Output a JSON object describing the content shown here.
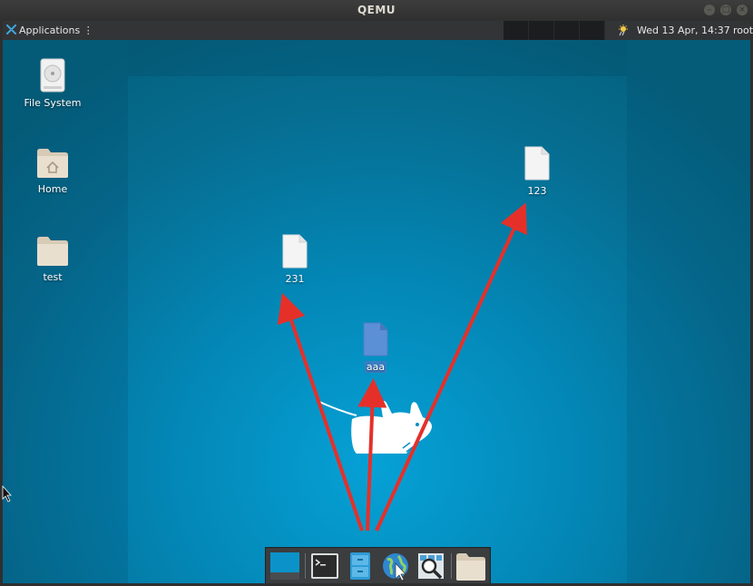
{
  "window": {
    "title": "QEMU"
  },
  "panel": {
    "applications_label": "Applications",
    "applications_suffix": "⋮",
    "clock": "Wed 13 Apr, 14:37",
    "user": "root"
  },
  "desktop": {
    "icons": [
      {
        "label": "File System",
        "icon": "drive-icon"
      },
      {
        "label": "Home",
        "icon": "home-folder-icon"
      },
      {
        "label": "test",
        "icon": "folder-icon"
      },
      {
        "label": "231",
        "icon": "file-icon"
      },
      {
        "label": "123",
        "icon": "file-icon"
      },
      {
        "label": "aaa",
        "icon": "file-icon",
        "selected": true
      }
    ]
  },
  "dock": {
    "items": [
      {
        "name": "show-desktop",
        "icon": "desktop-icon"
      },
      {
        "name": "terminal",
        "icon": "terminal-icon"
      },
      {
        "name": "file-manager",
        "icon": "file-manager-icon"
      },
      {
        "name": "web-browser",
        "icon": "globe-icon"
      },
      {
        "name": "app-finder",
        "icon": "magnifier-icon"
      },
      {
        "name": "folder",
        "icon": "folder-icon"
      }
    ]
  },
  "colors": {
    "arrow": "#e5302a",
    "selection": "#3a7ec4",
    "panel": "#333436"
  }
}
